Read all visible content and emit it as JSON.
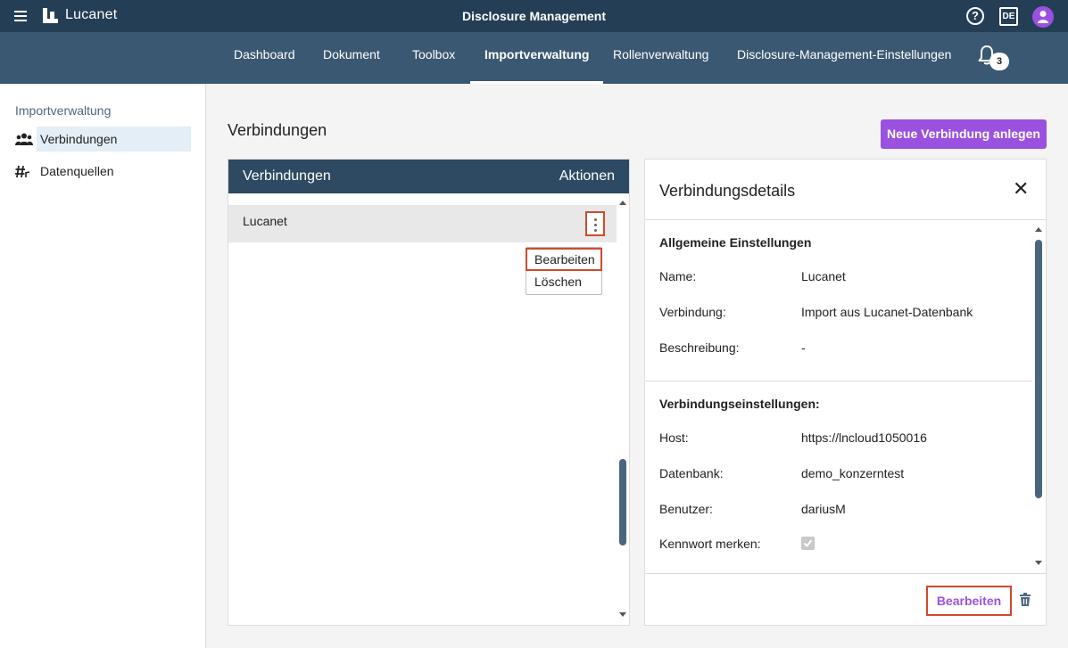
{
  "topbar": {
    "brand": "Lucanet",
    "title": "Disclosure Management",
    "lang": "DE",
    "help_glyph": "?"
  },
  "nav": {
    "tabs": [
      "Dashboard",
      "Dokument",
      "Toolbox",
      "Importverwaltung",
      "Rollenverwaltung",
      "Disclosure-Management-Einstellungen"
    ],
    "active": "Importverwaltung",
    "notification_count": "3"
  },
  "sidebar": {
    "title": "Importverwaltung",
    "items": [
      {
        "label": "Verbindungen",
        "icon": "people-icon",
        "active": true
      },
      {
        "label": "Datenquellen",
        "icon": "hash-icon",
        "active": false
      }
    ]
  },
  "main": {
    "heading": "Verbindungen",
    "new_button": "Neue Verbindung anlegen"
  },
  "connections": {
    "col_name": "Verbindungen",
    "col_actions": "Aktionen",
    "rows": [
      "Lucanet"
    ],
    "menu": [
      "Bearbeiten",
      "Löschen"
    ]
  },
  "details": {
    "title": "Verbindungsdetails",
    "close_glyph": "✕",
    "general": {
      "title": "Allgemeine Einstellungen",
      "name_label": "Name:",
      "name_value": "Lucanet",
      "conn_label": "Verbindung:",
      "conn_value": "Import aus Lucanet-Datenbank",
      "desc_label": "Beschreibung:",
      "desc_value": "-"
    },
    "settings": {
      "title": "Verbindungseinstellungen:",
      "host_label": "Host:",
      "host_value": "https://lncloud1050016",
      "db_label": "Datenbank:",
      "db_value": "demo_konzerntest",
      "user_label": "Benutzer:",
      "user_value": "dariusM",
      "remember_label": "Kennwort merken:",
      "remember_checked": true
    },
    "edit_button": "Bearbeiten"
  },
  "colors": {
    "topbar": "#243e55",
    "navbar": "#3b5872",
    "accent": "#9b51e0",
    "highlight": "#d14a2a"
  }
}
